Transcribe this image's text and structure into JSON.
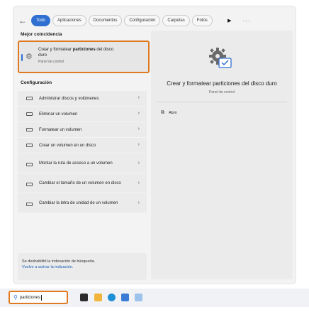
{
  "nav": {
    "chips": [
      "Todo",
      "Aplicaciones",
      "Documentos",
      "Configuración",
      "Carpetas",
      "Fotos"
    ],
    "back_glyph": "←",
    "play_glyph": "▶",
    "more_glyph": "···"
  },
  "best_match": {
    "heading": "Mejor coincidencia",
    "title_prefix": "Crear y formatear ",
    "title_bold": "particiones",
    "title_suffix": " del disco",
    "title_line2": "duro",
    "subtitle": "Panel de control",
    "icon": "gear-icon"
  },
  "settings": {
    "heading": "Configuración",
    "items": [
      {
        "label": "Administrar discos y volúmenes"
      },
      {
        "label": "Eliminar un volumen"
      },
      {
        "label": "Formatear un volumen"
      },
      {
        "label": "Crear un volumen en un disco"
      },
      {
        "label": "Montar la ruta de acceso a un volumen"
      },
      {
        "label": "Cambiar el tamaño de un volumen en disco"
      },
      {
        "label": "Cambiar la letra de unidad de un volumen"
      }
    ],
    "chevron": "›"
  },
  "footer": {
    "message": "Se deshabilitó la indexación de búsqueda.",
    "link": "Vuelve a activar la indización."
  },
  "detail": {
    "title": "Crear y formatear particiones del disco duro",
    "subtitle": "Panel de control",
    "open_label": "Abrir",
    "open_icon": "open-external-icon"
  },
  "taskbar": {
    "search_value": "particiones",
    "search_icon": "search-icon",
    "colors": {
      "highlight": "#e07a22",
      "accent": "#2f6fd1"
    }
  }
}
